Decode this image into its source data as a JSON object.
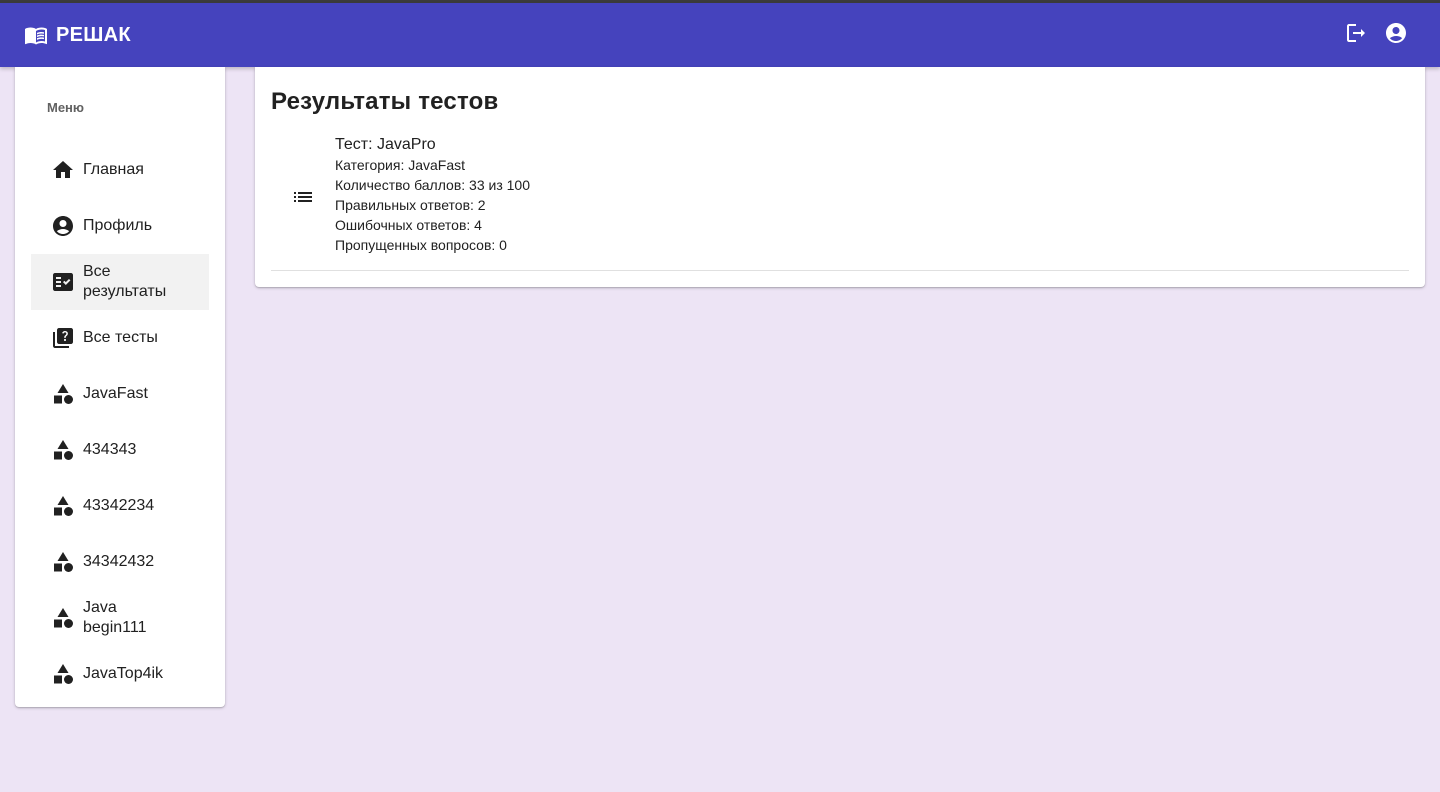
{
  "app": {
    "title": "РЕШАК"
  },
  "header": {
    "actions": [
      {
        "icon": "logout-icon"
      },
      {
        "icon": "account-circle-icon"
      }
    ]
  },
  "sidebar": {
    "subheader": "Меню",
    "items": [
      {
        "label": "Главная",
        "icon": "home-icon",
        "active": false
      },
      {
        "label": "Профиль",
        "icon": "account-circle-icon",
        "active": false
      },
      {
        "label": "Все результаты",
        "icon": "fact-check-icon",
        "active": true
      },
      {
        "label": "Все тесты",
        "icon": "quiz-icon",
        "active": false
      },
      {
        "label": "JavaFast",
        "icon": "category-icon",
        "active": false
      },
      {
        "label": "434343",
        "icon": "category-icon",
        "active": false
      },
      {
        "label": "43342234",
        "icon": "category-icon",
        "active": false
      },
      {
        "label": "34342432",
        "icon": "category-icon",
        "active": false
      },
      {
        "label": "Java begin111",
        "icon": "category-icon",
        "active": false
      },
      {
        "label": "JavaTop4ik",
        "icon": "category-icon",
        "active": false
      }
    ]
  },
  "main": {
    "title": "Результаты тестов",
    "results": [
      {
        "test": "Тест: JavaPro",
        "category": "Категория: JavaFast",
        "score": "Количество баллов: 33 из 100",
        "correct": "Правильных ответов: 2",
        "wrong": "Ошибочных ответов: 4",
        "skipped": "Пропущенных вопросов: 0"
      }
    ]
  },
  "colors": {
    "appbar": "#4543bd",
    "background": "#ede4f5",
    "active_item": "#f2f2f2"
  }
}
